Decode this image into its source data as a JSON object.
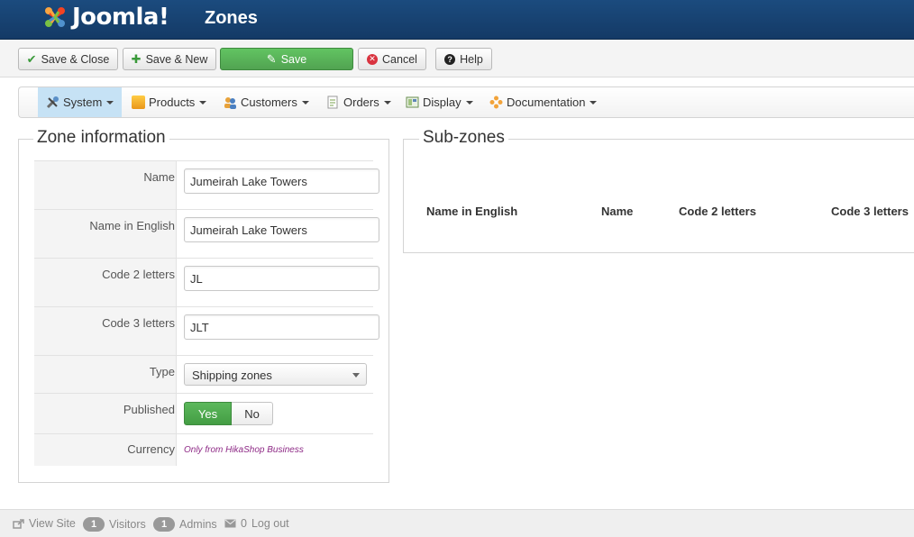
{
  "header": {
    "logo_text": "Joomla!",
    "page_title": "Zones"
  },
  "toolbar": {
    "save_close_label": "Save & Close",
    "save_new_label": "Save & New",
    "save_label": "Save",
    "cancel_label": "Cancel",
    "help_label": "Help"
  },
  "menu": {
    "items": [
      {
        "label": "System",
        "icon": "tools-icon"
      },
      {
        "label": "Products",
        "icon": "box-icon"
      },
      {
        "label": "Customers",
        "icon": "users-icon"
      },
      {
        "label": "Orders",
        "icon": "orders-icon"
      },
      {
        "label": "Display",
        "icon": "display-icon"
      },
      {
        "label": "Documentation",
        "icon": "help-flower-icon"
      }
    ],
    "active": "System"
  },
  "zone_info": {
    "legend": "Zone information",
    "fields": {
      "name": {
        "label": "Name",
        "value": "Jumeirah Lake Towers"
      },
      "name_english": {
        "label": "Name in English",
        "value": "Jumeirah Lake Towers"
      },
      "code2": {
        "label": "Code 2 letters",
        "value": "JL"
      },
      "code3": {
        "label": "Code 3 letters",
        "value": "JLT"
      },
      "type": {
        "label": "Type",
        "value": "Shipping zones"
      },
      "published": {
        "label": "Published",
        "yes": "Yes",
        "no": "No",
        "selected": "Yes"
      },
      "currency": {
        "label": "Currency",
        "note": "Only from HikaShop Business"
      }
    }
  },
  "subzones": {
    "legend": "Sub-zones",
    "columns": [
      "Name in English",
      "Name",
      "Code 2 letters",
      "Code 3 letters"
    ]
  },
  "footer": {
    "view_site": "View Site",
    "visitors_count": "1",
    "visitors_label": "Visitors",
    "admins_count": "1",
    "admins_label": "Admins",
    "logout_count": "0",
    "logout_label": "Log out"
  },
  "colors": {
    "header_bg": "#1b4b7e",
    "save_green": "#51a351",
    "active_menu": "#c6e2f5",
    "note_purple": "#8e2a86"
  }
}
